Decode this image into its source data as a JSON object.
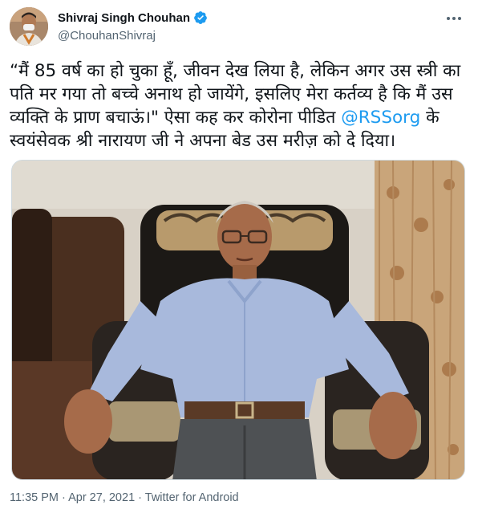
{
  "author": {
    "display_name": "Shivraj Singh Chouhan",
    "handle": "@ChouhanShivraj",
    "verified_icon": "verified-badge-icon",
    "avatar_icon": "avatar"
  },
  "more_icon": "more-options-icon",
  "tweet": {
    "text_before_mention": "“मैं 85 वर्ष का हो चुका हूँ, जीवन देख लिया है, लेकिन अगर उस स्त्री का पति मर गया तो बच्चे अनाथ हो जायेंगे, इसलिए मेरा कर्तव्य है कि मैं उस व्यक्ति के प्राण बचाऊं।\" ऐसा कह कर कोरोना पीडित ",
    "mention": "@RSSorg",
    "text_after_mention": " के स्वयंसेवक श्री नारायण जी ने अपना बेड उस मरीज़ को दे दिया।"
  },
  "meta": {
    "time": "11:35 PM",
    "separator": " · ",
    "date": "Apr 27, 2021",
    "source": "Twitter for Android"
  },
  "colors": {
    "link": "#1d9bf0",
    "secondary_text": "#536471",
    "primary_text": "#0f1419"
  }
}
